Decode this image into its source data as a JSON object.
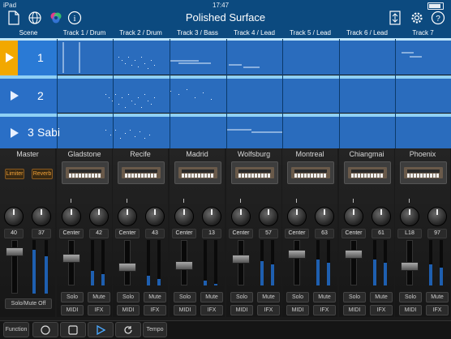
{
  "status": {
    "device": "iPad",
    "time": "17:47"
  },
  "nav": {
    "title": "Polished Surface"
  },
  "header": {
    "scene_label": "Scene",
    "tracks": [
      "Track 1 / Drum",
      "Track 2 / Drum",
      "Track 3 / Bass",
      "Track 4 / Lead",
      "Track 5 / Lead",
      "Track 6 / Lead",
      "Track 7"
    ]
  },
  "scenes": [
    {
      "number": "1",
      "name": ""
    },
    {
      "number": "2",
      "name": ""
    },
    {
      "number": "3",
      "name": "Sabi"
    }
  ],
  "mixer": {
    "master": {
      "name": "Master",
      "limiter": "Limiter",
      "reverb": "Reverb",
      "val1": "40",
      "val2": "37",
      "solo_mute_off": "Solo/Mute Off"
    },
    "strips": [
      {
        "name": "Gladstone",
        "pan": "Center",
        "vol": "42",
        "solo": "Solo",
        "mute": "Mute",
        "midi": "MIDI",
        "ifx": "IFX"
      },
      {
        "name": "Recife",
        "pan": "Center",
        "vol": "43",
        "solo": "Solo",
        "mute": "Mute",
        "midi": "MIDI",
        "ifx": "IFX"
      },
      {
        "name": "Madrid",
        "pan": "Center",
        "vol": "13",
        "solo": "Solo",
        "mute": "Mute",
        "midi": "MIDI",
        "ifx": "IFX"
      },
      {
        "name": "Wolfsburg",
        "pan": "Center",
        "vol": "57",
        "solo": "Solo",
        "mute": "Mute",
        "midi": "MIDI",
        "ifx": "IFX"
      },
      {
        "name": "Montreal",
        "pan": "Center",
        "vol": "63",
        "solo": "Solo",
        "mute": "Mute",
        "midi": "MIDI",
        "ifx": "IFX"
      },
      {
        "name": "Chiangmai",
        "pan": "Center",
        "vol": "61",
        "solo": "Solo",
        "mute": "Mute",
        "midi": "MIDI",
        "ifx": "IFX"
      },
      {
        "name": "Phoenix",
        "pan": "L18",
        "vol": "97",
        "solo": "Solo",
        "mute": "Mute",
        "midi": "MIDI",
        "ifx": "IFX"
      }
    ]
  },
  "transport": {
    "function": "Function",
    "tempo": "Tempo"
  },
  "colors": {
    "accent": "#0c4a7f",
    "scene_blue": "#2a6cbd",
    "highlight": "#8fd0f5",
    "orange": "#f2a33a"
  }
}
